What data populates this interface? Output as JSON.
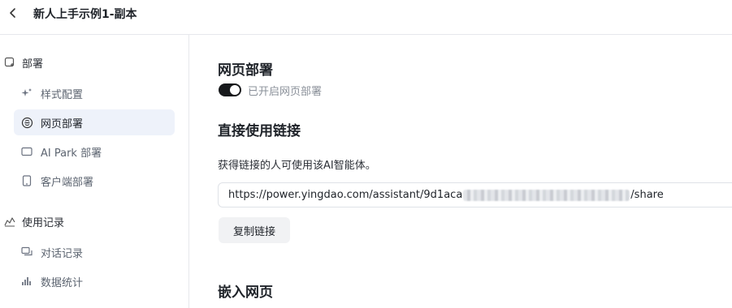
{
  "header": {
    "title": "新人上手示例1-副本",
    "back_icon": "chevron-left-icon"
  },
  "sidebar": {
    "groups": [
      {
        "label": "部署",
        "icon": "deploy-icon",
        "items": [
          {
            "label": "样式配置",
            "icon": "sparkle-icon",
            "active": false
          },
          {
            "label": "网页部署",
            "icon": "link-icon",
            "active": true
          },
          {
            "label": "AI Park 部署",
            "icon": "window-icon",
            "active": false
          },
          {
            "label": "客户端部署",
            "icon": "tablet-icon",
            "active": false
          }
        ]
      },
      {
        "label": "使用记录",
        "icon": "activity-icon",
        "items": [
          {
            "label": "对话记录",
            "icon": "chat-icon",
            "active": false
          },
          {
            "label": "数据统计",
            "icon": "bar-chart-icon",
            "active": false
          }
        ]
      }
    ]
  },
  "main": {
    "web_deploy": {
      "title": "网页部署",
      "toggle_on": true,
      "toggle_label": "已开启网页部署"
    },
    "direct_link": {
      "title": "直接使用链接",
      "description": "获得链接的人可使用该AI智能体。",
      "url_prefix": "https://power.yingdao.com/assistant/9d1aca",
      "url_suffix": "/share",
      "copy_button": "复制链接"
    },
    "embed": {
      "title": "嵌入网页"
    }
  },
  "colors": {
    "active_bg": "#eef2fa",
    "toggle_on": "#17191c",
    "border": "#e6e8ec"
  }
}
